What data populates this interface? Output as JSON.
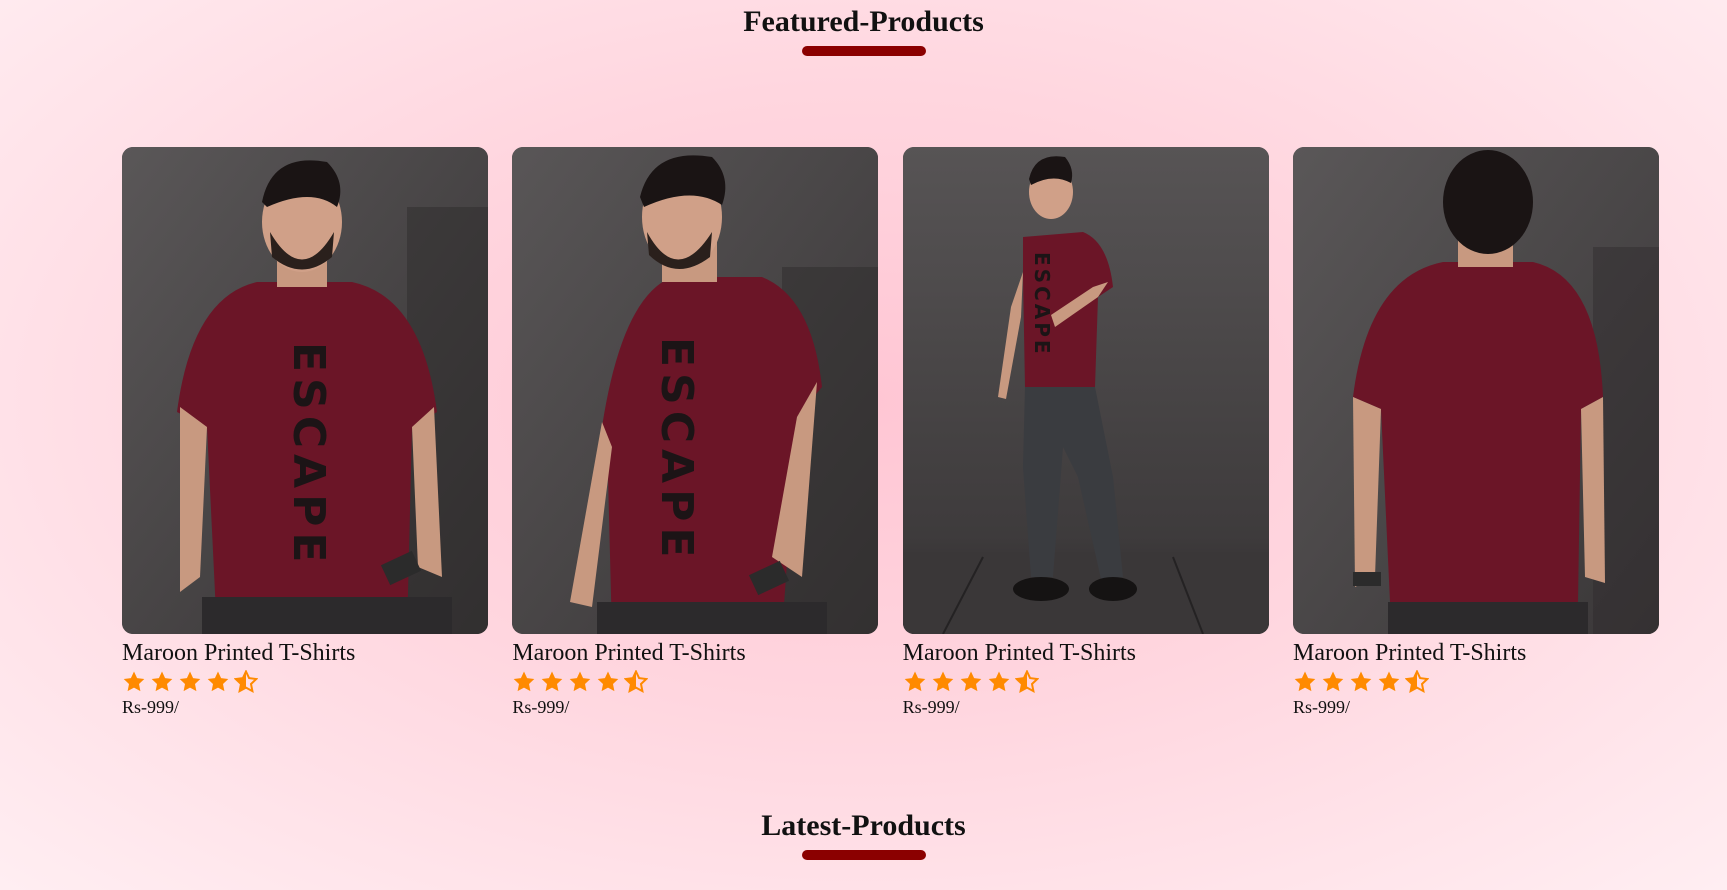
{
  "colors": {
    "accent": "#8b0000",
    "star": "#ff8a00",
    "shirt": "#6b1527",
    "wall": "#4a4748"
  },
  "featured": {
    "heading": "Featured-Products",
    "products": [
      {
        "title": "Maroon Printed T-Shirts",
        "rating": 4.5,
        "price": "Rs-999/",
        "image": "model-front-closeup"
      },
      {
        "title": "Maroon Printed T-Shirts",
        "rating": 4.5,
        "price": "Rs-999/",
        "image": "model-side-closeup"
      },
      {
        "title": "Maroon Printed T-Shirts",
        "rating": 4.5,
        "price": "Rs-999/",
        "image": "model-full-body"
      },
      {
        "title": "Maroon Printed T-Shirts",
        "rating": 4.5,
        "price": "Rs-999/",
        "image": "model-back-view"
      }
    ]
  },
  "latest": {
    "heading": "Latest-Products"
  }
}
